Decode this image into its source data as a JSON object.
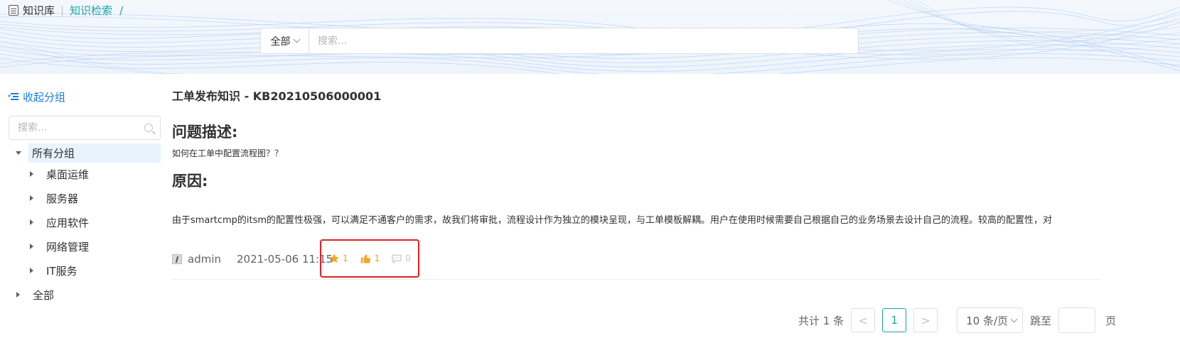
{
  "breadcrumb": {
    "root": "知识库",
    "separator": "|",
    "current": "知识检索",
    "trail": "/"
  },
  "search": {
    "scope": "全部",
    "placeholder": "搜索..."
  },
  "sidebar": {
    "collapse_label": "收起分组",
    "search_placeholder": "搜索...",
    "tree": {
      "root_label": "所有分组",
      "children": [
        {
          "label": "桌面运维"
        },
        {
          "label": "服务器"
        },
        {
          "label": "应用软件"
        },
        {
          "label": "网络管理"
        },
        {
          "label": "IT服务"
        }
      ],
      "other_label": "全部"
    }
  },
  "article": {
    "title": "工单发布知识 - KB20210506000001",
    "problem_heading": "问题描述:",
    "problem_text": "如何在工单中配置流程图？？",
    "cause_heading": "原因:",
    "cause_text": "由于smartcmp的itsm的配置性极强，可以满足不通客户的需求，故我们将审批，流程设计作为独立的模块呈现，与工单模板解耦。用户在使用时候需要自己根据自己的业务场景去设计自己的流程。较高的配置性，对",
    "author": "admin",
    "date": "2021-05-06 11:15",
    "stats": {
      "favorites": "1",
      "likes": "1",
      "comments": "0"
    }
  },
  "pagination": {
    "total": "共计 1 条",
    "prev": "<",
    "current_page": "1",
    "next": ">",
    "page_size": "10 条/页",
    "jump_label": "跳至",
    "page_suffix": "页"
  },
  "colors": {
    "accent": "#1aa5a5",
    "link": "#1a7fd4",
    "star": "#f0a020",
    "highlight_border": "#e02020"
  }
}
